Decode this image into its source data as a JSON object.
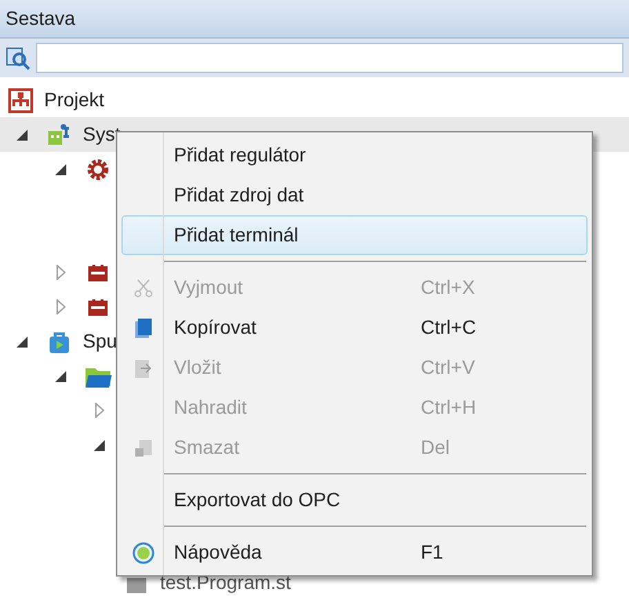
{
  "panel": {
    "title": "Sestava"
  },
  "tree": [
    {
      "label": "Projekt",
      "selected": false,
      "children": [
        {
          "label": "Syst",
          "selected": true,
          "expanded": true,
          "children": [
            {
              "selected": false,
              "expanded": true
            },
            {
              "selected": false,
              "expanded": false
            },
            {
              "selected": false,
              "expanded": false
            }
          ]
        },
        {
          "label": "Spu",
          "selected": false,
          "expanded": true,
          "children": [
            {
              "selected": false,
              "expanded": true,
              "children": [
                {
                  "selected": false,
                  "expanded": false
                },
                {
                  "selected": false,
                  "expanded": true
                },
                {
                  "label": "test.Program.st",
                  "selected": false
                }
              ]
            }
          ]
        }
      ]
    }
  ],
  "context_menu": [
    {
      "kind": "item",
      "label": "Přidat regulátor",
      "disabled": false,
      "selected": false
    },
    {
      "kind": "item",
      "label": "Přidat zdroj dat",
      "disabled": false,
      "selected": false
    },
    {
      "kind": "item",
      "label": "Přidat terminál",
      "disabled": false,
      "selected": true
    },
    {
      "kind": "separator"
    },
    {
      "kind": "item",
      "label": "Vyjmout",
      "shortcut": "Ctrl+X",
      "disabled": true,
      "selected": false
    },
    {
      "kind": "item",
      "label": "Kopírovat",
      "shortcut": "Ctrl+C",
      "disabled": false,
      "selected": false
    },
    {
      "kind": "item",
      "label": "Vložit",
      "shortcut": "Ctrl+V",
      "disabled": true,
      "selected": false
    },
    {
      "kind": "item",
      "label": "Nahradit",
      "shortcut": "Ctrl+H",
      "disabled": true,
      "selected": false
    },
    {
      "kind": "item",
      "label": "Smazat",
      "shortcut": "Del",
      "disabled": true,
      "selected": false
    },
    {
      "kind": "separator"
    },
    {
      "kind": "item",
      "label": "Exportovat do OPC",
      "disabled": false,
      "selected": false
    },
    {
      "kind": "separator"
    },
    {
      "kind": "item",
      "label": "Nápověda",
      "shortcut": "F1",
      "disabled": false,
      "selected": false
    }
  ]
}
